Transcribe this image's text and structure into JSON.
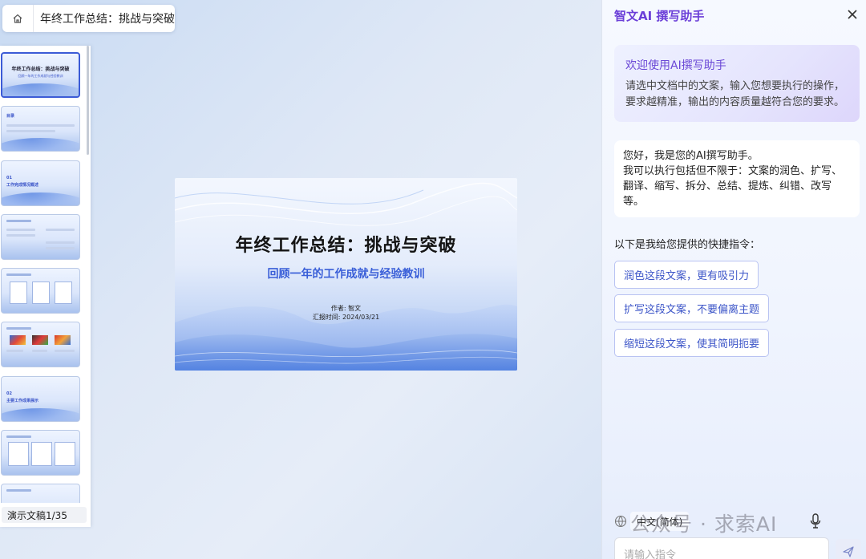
{
  "app": {
    "doc_title": "年终工作总结：挑战与突破"
  },
  "thumbs": {
    "slide1": {
      "title": "年终工作总结：挑战与突破",
      "subtitle": "回顾一年的工作成就与经验教训"
    },
    "slide2": {
      "label": "目录"
    },
    "slide3": {
      "number": "01",
      "label": "工作完成情况概述"
    },
    "slide7": {
      "number": "02",
      "label": "主要工作成果展示"
    },
    "footer": "演示文稿1/35"
  },
  "slide": {
    "title": "年终工作总结：挑战与突破",
    "subtitle": "回顾一年的工作成就与经验教训",
    "author": "作者: 智文",
    "date": "汇报时间: 2024/03/21"
  },
  "ai": {
    "title": "智文AI 撰写助手",
    "welcome_title": "欢迎使用AI撰写助手",
    "welcome_text": "请选中文档中的文案，输入您想要执行的操作，要求越精准，输出的内容质量越符合您的要求。",
    "intro_line1": "您好，我是您的AI撰写助手。",
    "intro_line2": "我可以执行包括但不限于：文案的润色、扩写、翻译、缩写、拆分、总结、提炼、纠错、改写等。",
    "quick_label": "以下是我给您提供的快捷指令：",
    "quick": [
      "润色这段文案，更有吸引力",
      "扩写这段文案，不要偏离主题",
      "缩短这段文案，使其简明扼要"
    ],
    "language": "中文(简体)",
    "input_placeholder": "请输入指令",
    "watermark": "公众号 · 求索AI"
  },
  "colors": {
    "accent": "#6b3fd8",
    "link": "#3c55c8",
    "slide_subtitle": "#3a5fd8"
  }
}
